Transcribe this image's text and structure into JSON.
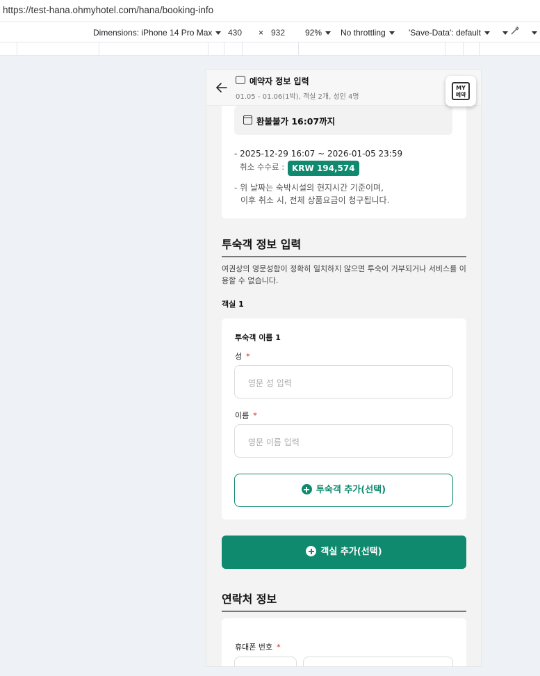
{
  "browser": {
    "url": "https://test-hana.ohmyhotel.com/hana/booking-info"
  },
  "devtools": {
    "dimensions_label": "Dimensions: iPhone 14 Pro Max",
    "width": "430",
    "times": "×",
    "height": "932",
    "zoom": "92%",
    "throttling": "No throttling",
    "save_data": "'Save-Data': default"
  },
  "header": {
    "title": "예약자 정보 입력",
    "subtitle": "01.05 - 01.06(1박), 객실 2개, 성인 4명",
    "my_button_line1": "MY",
    "my_button_line2": "예약"
  },
  "refund": {
    "pill_text": "환불불가 16:07까지",
    "period": "- 2025-12-29 16:07 ~ 2026-01-05 23:59",
    "fee_label": "취소 수수료 :",
    "fee_amount": "KRW 194,574",
    "note_line1": "- 위 날짜는 숙박시설의 현지시간 기준이며,",
    "note_line2": "이후 취소 시, 전체 상품요금이 청구됩니다."
  },
  "guest_section": {
    "title": "투숙객 정보 입력",
    "notice": "여권상의 영문성함이 정확히 일치하지 않으면 투숙이 거부되거나 서비스를 이용할 수 없습니다.",
    "room_label": "객실 1",
    "guest_title": "투숙객 이름 1",
    "last_name_label": "성",
    "last_name_placeholder": "영문 성 입력",
    "first_name_label": "이름",
    "first_name_placeholder": "영문 이름 입력",
    "required_mark": "*",
    "add_guest_label": "투숙객 추가(선택)",
    "add_room_label": "객실 추가(선택)"
  },
  "contact_section": {
    "title": "연락처 정보",
    "phone_label": "휴대폰 번호"
  },
  "colors": {
    "accent": "#0f8a6f",
    "required": "#d31f1f"
  }
}
